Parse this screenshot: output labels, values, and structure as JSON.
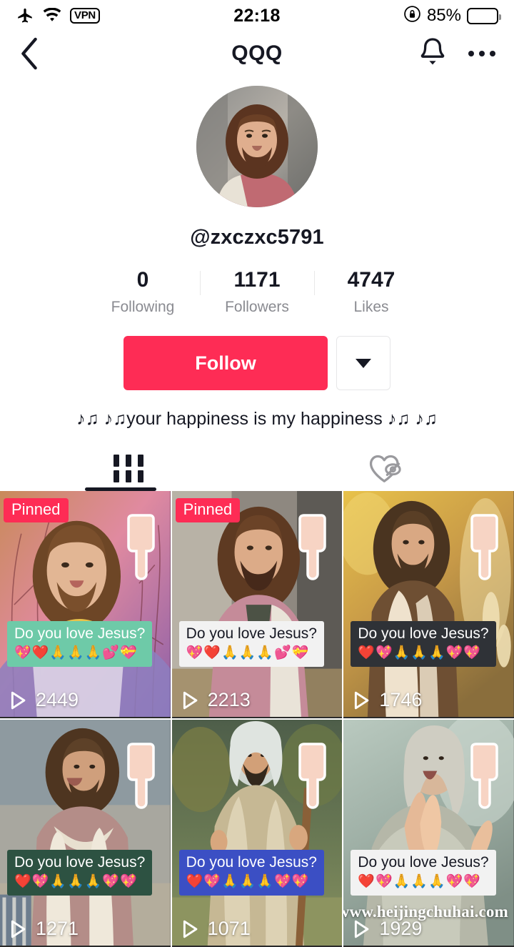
{
  "status_bar": {
    "time": "22:18",
    "battery_percent": "85%",
    "icons": [
      "airplane-mode-icon",
      "wifi-icon",
      "rotation-lock-icon",
      "battery-icon"
    ],
    "vpn_label": "VPN"
  },
  "nav": {
    "title": "QQQ",
    "back_icon": "chevron-left-icon",
    "bell_icon": "bell-icon",
    "more_icon": "more-options-icon"
  },
  "profile": {
    "username": "@zxczxc5791",
    "bio": "♪♫ ♪♫your happiness is my happiness ♪♫ ♪♫",
    "avatar_alt": "profile-avatar",
    "stats": [
      {
        "value": "0",
        "label": "Following"
      },
      {
        "value": "1171",
        "label": "Followers"
      },
      {
        "value": "4747",
        "label": "Likes"
      }
    ],
    "follow_label": "Follow",
    "dropdown_icon": "chevron-down-icon"
  },
  "tabs": [
    {
      "name": "videos",
      "icon": "grid-icon",
      "active": true
    },
    {
      "name": "liked",
      "icon": "heart-hidden-icon",
      "active": false
    }
  ],
  "colors": {
    "accent": "#FE2C55",
    "text_primary": "#161823",
    "text_secondary": "#8A8B91"
  },
  "watermark": "www.heijingchuhai.com",
  "videos": [
    {
      "pinned": true,
      "pinned_label": "Pinned",
      "views": "2449",
      "caption": "Do you love Jesus?",
      "caption_emoji": "💖❤️🙏🙏🙏💕💝",
      "caption_bg": "#6ecaa8",
      "caption_color": "#ffffff",
      "art": "jesus-portrait-pink-trees"
    },
    {
      "pinned": true,
      "pinned_label": "Pinned",
      "views": "2213",
      "caption": "Do you love Jesus?",
      "caption_emoji": "💖❤️🙏🙏🙏💕💝",
      "caption_bg": "#f2f2f2",
      "caption_color": "#161823",
      "art": "jesus-pink-robe-street"
    },
    {
      "pinned": false,
      "pinned_label": "",
      "views": "1746",
      "caption": "Do you love Jesus?",
      "caption_emoji": "❤️💖🙏🙏🙏💖💖",
      "caption_bg": "#2f3237",
      "caption_color": "#ffffff",
      "art": "jesus-autumn-field"
    },
    {
      "pinned": false,
      "pinned_label": "",
      "views": "1271",
      "caption": "Do you love Jesus?",
      "caption_emoji": "❤️💖🙏🙏🙏💖💖",
      "caption_bg": "#2d5242",
      "caption_color": "#ffffff",
      "art": "jesus-smiling-street"
    },
    {
      "pinned": false,
      "pinned_label": "",
      "views": "1071",
      "caption": "Do you love Jesus?",
      "caption_emoji": "❤️💖🙏🙏🙏💖💖",
      "caption_bg": "#3b4fc4",
      "caption_color": "#ffffff",
      "art": "jesus-staff-field"
    },
    {
      "pinned": false,
      "pinned_label": "",
      "views": "1929",
      "caption": "Do you love Jesus?",
      "caption_emoji": "❤️💖🙏🙏🙏💖💖",
      "caption_bg": "#f2f2f2",
      "caption_color": "#161823",
      "art": "jesus-praying-looking-up"
    }
  ]
}
